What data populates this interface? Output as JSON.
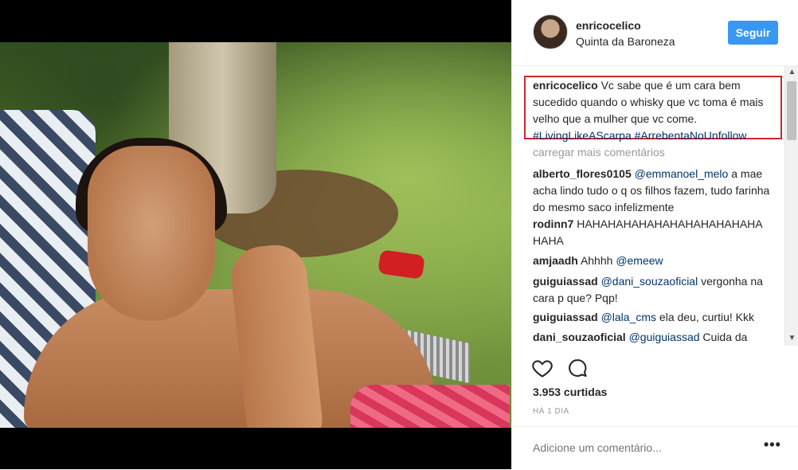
{
  "post": {
    "username": "enricocelico",
    "location": "Quinta da Baroneza",
    "follow_label": "Seguir"
  },
  "caption": {
    "user": "enricocelico",
    "text": "Vc sabe que é um cara bem sucedido quando o whisky que vc toma é mais velho que a mulher que vc come.",
    "tags": "#LivingLikeAScarpa #ArrebentaNoUnfollow"
  },
  "load_more": "carregar mais comentários",
  "comments": [
    {
      "user": "alberto_flores0105",
      "mention": "@emmanoel_melo",
      "text": "a mae acha lindo tudo o q os filhos fazem, tudo farinha do mesmo saco infelizmente"
    },
    {
      "user": "rodinn7",
      "mention": "",
      "text": "HAHAHAHAHAHAHAHAHAHAHAHA HAHA"
    },
    {
      "user": "amjaadh",
      "mention": "@emeew",
      "text": "Ahhhh"
    },
    {
      "user": "guiguiassad",
      "mention": "@dani_souzaoficial",
      "text": "vergonha na cara p que? Pqp!"
    },
    {
      "user": "guiguiassad",
      "mention": "@lala_cms",
      "text": "ela deu, curtiu! Kkk"
    },
    {
      "user": "dani_souzaoficial",
      "mention": "@guiguiassad",
      "text": "Cuida da"
    }
  ],
  "likes": "3.953 curtidas",
  "time": "HÁ 1 DIA",
  "add_comment_placeholder": "Adicione um comentário...",
  "more_label": "•••",
  "scroll": {
    "up": "▲",
    "down": "▼"
  },
  "colors": {
    "follow": "#3897f0",
    "highlight_box": "#d5252c",
    "link": "#003569"
  },
  "icons": {
    "like": "heart-icon",
    "comment": "comment-bubble-icon",
    "more": "more-options-icon"
  }
}
